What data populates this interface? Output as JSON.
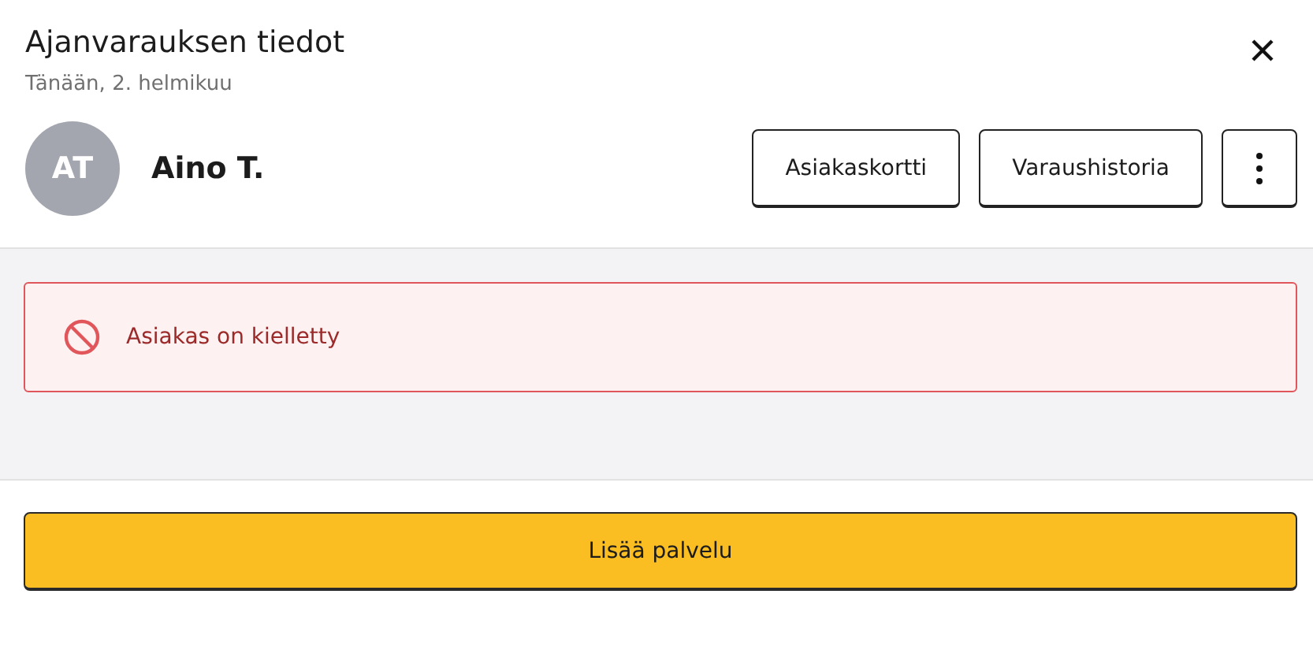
{
  "header": {
    "title": "Ajanvarauksen tiedot",
    "subtitle": "Tänään, 2. helmikuu"
  },
  "customer": {
    "initials": "AT",
    "name": "Aino T."
  },
  "actions": [
    {
      "label": "Asiakaskortti"
    },
    {
      "label": "Varaushistoria"
    }
  ],
  "alert": {
    "kind": "error",
    "message": "Asiakas on kielletty"
  },
  "primary_button": {
    "label": "Lisää palvelu"
  }
}
